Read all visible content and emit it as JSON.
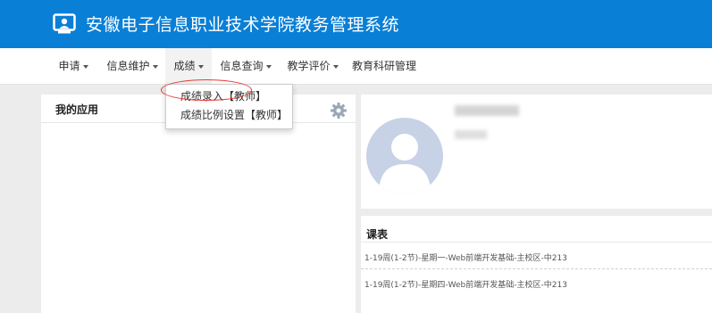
{
  "header": {
    "title": "安徽电子信息职业技术学院教务管理系统",
    "logo_icon": "monitor-user-icon"
  },
  "menu": [
    {
      "label": "申请",
      "has_caret": true
    },
    {
      "label": "信息维护",
      "has_caret": true
    },
    {
      "label": "成绩",
      "has_caret": true,
      "active": true
    },
    {
      "label": "信息查询",
      "has_caret": true
    },
    {
      "label": "教学评价",
      "has_caret": true
    },
    {
      "label": "教育科研管理",
      "has_caret": false
    }
  ],
  "dropdown": {
    "items": [
      {
        "label": "成绩录入【教师】"
      },
      {
        "label": "成绩比例设置【教师】"
      }
    ],
    "highlight_color": "#e53935"
  },
  "apps_panel": {
    "title": "我的应用",
    "settings_icon": "gear-icon"
  },
  "profile_panel": {
    "avatar_icon": "default-avatar-icon"
  },
  "schedule_panel": {
    "title": "课表",
    "rows": [
      "1-19周(1-2节)-星期一-Web前端开发基础-主校区-中213",
      "1-19周(1-2节)-星期四-Web前端开发基础-主校区-中213"
    ]
  },
  "colors": {
    "brand": "#0a7fd6",
    "background": "#ececec"
  }
}
